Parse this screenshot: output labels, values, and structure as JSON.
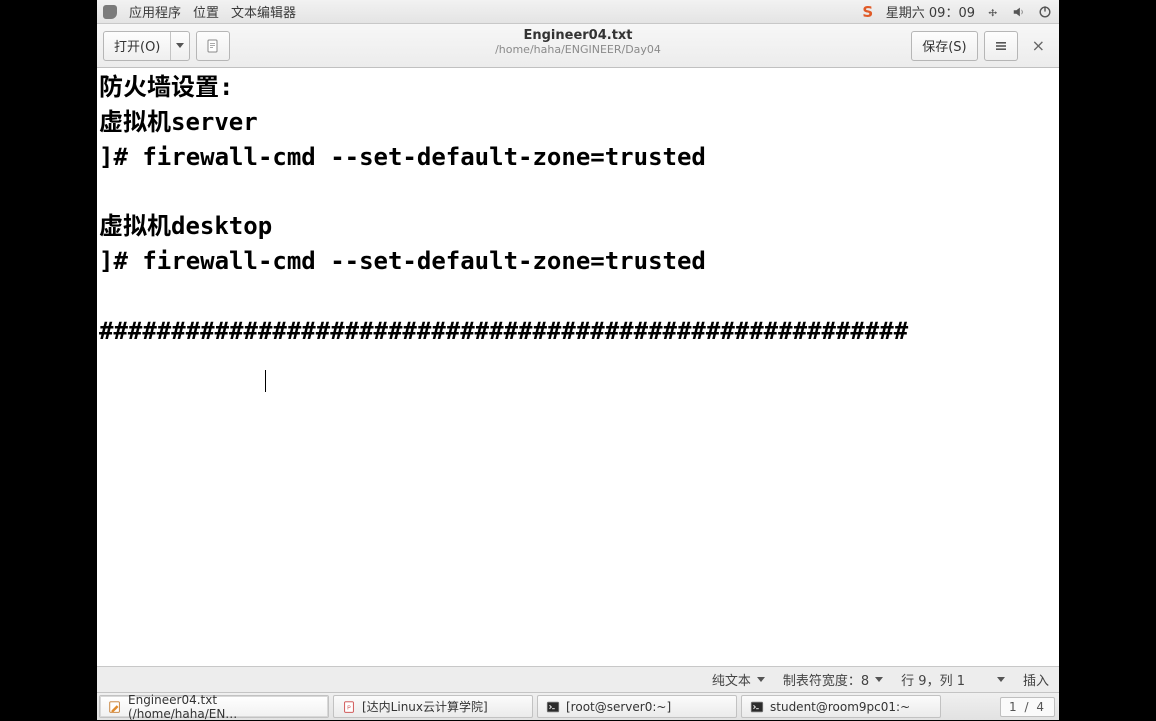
{
  "panel": {
    "apps": "应用程序",
    "places": "位置",
    "editor": "文本编辑器",
    "clock": "星期六 09：09"
  },
  "toolbar": {
    "open": "打开(O)",
    "save": "保存(S)",
    "title": "Engineer04.txt",
    "subtitle": "/home/haha/ENGINEER/Day04"
  },
  "document": {
    "lines": [
      "防火墙设置:",
      "虚拟机server",
      "]# firewall-cmd --set-default-zone=trusted",
      "",
      "虚拟机desktop",
      "]# firewall-cmd --set-default-zone=trusted",
      "",
      "########################################################"
    ]
  },
  "status": {
    "syntax": "纯文本",
    "tabwidth": "制表符宽度：8",
    "position": "行 9，列 1",
    "insert": "插入"
  },
  "tasks": [
    {
      "label": "Engineer04.txt (/home/haha/EN…",
      "icon": "editor",
      "active": true
    },
    {
      "label": "[达内Linux云计算学院]",
      "icon": "pdf",
      "active": false
    },
    {
      "label": "[root@server0:~]",
      "icon": "terminal",
      "active": false
    },
    {
      "label": "student@room9pc01:~",
      "icon": "terminal",
      "active": false
    }
  ],
  "workspace": "1 / 4"
}
